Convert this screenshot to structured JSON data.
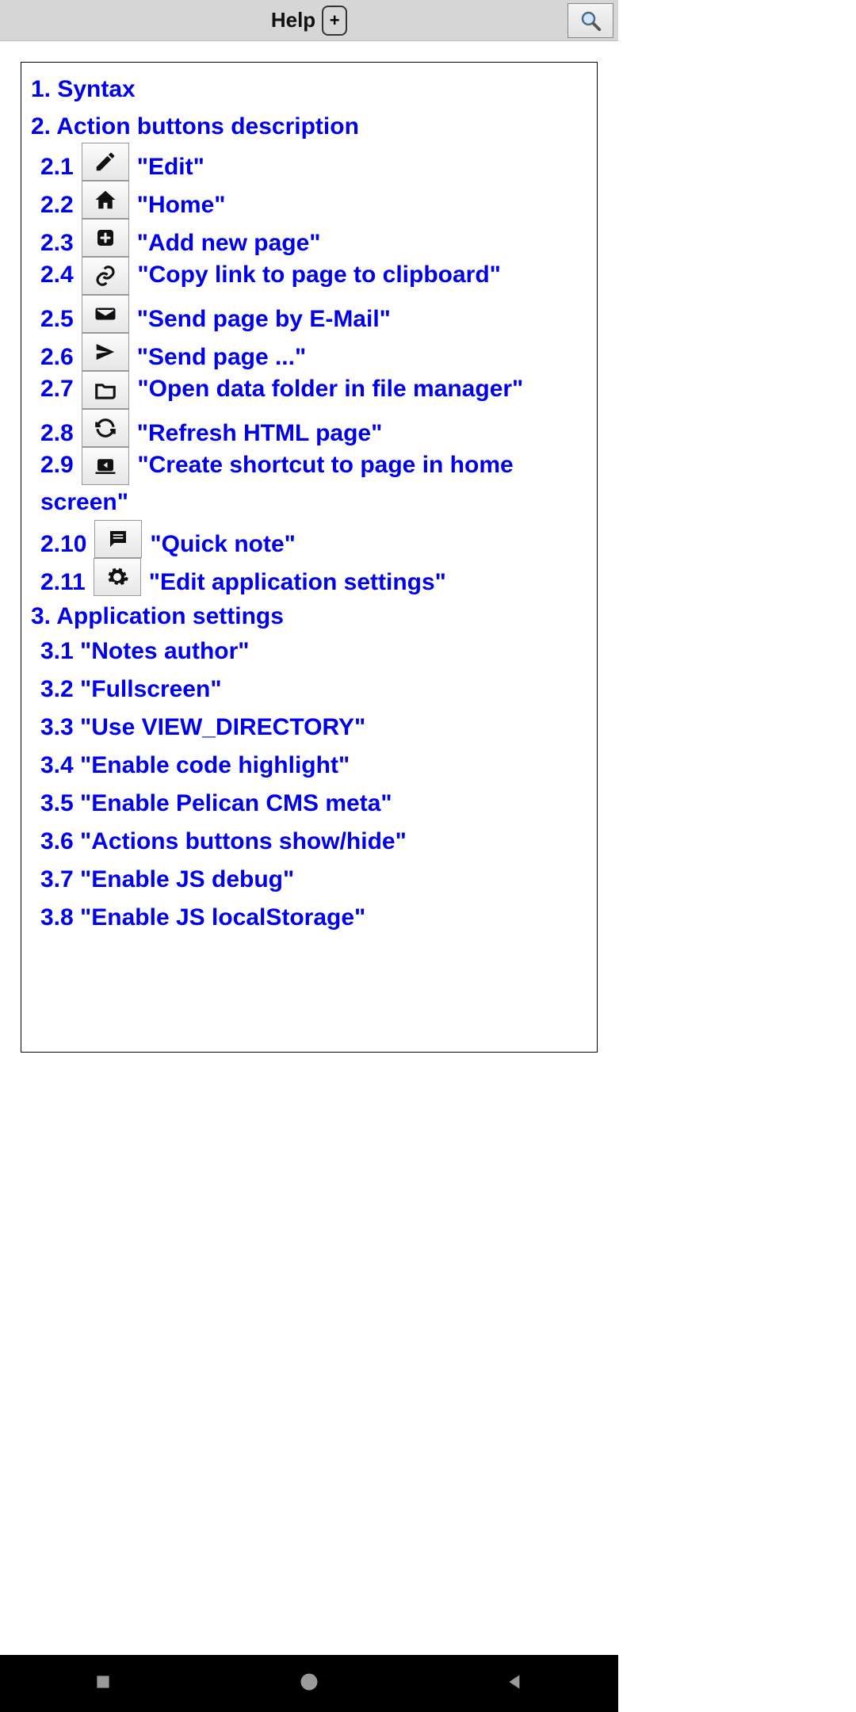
{
  "header": {
    "title": "Help",
    "plus": "+",
    "search_icon": "search-icon"
  },
  "toc": {
    "s1": "1. Syntax",
    "s2": "2. Action buttons description",
    "s2_items": [
      {
        "num": "2.1",
        "icon": "pencil-icon",
        "label": "\"Edit\""
      },
      {
        "num": "2.2",
        "icon": "home-icon",
        "label": "\"Home\""
      },
      {
        "num": "2.3",
        "icon": "add-box-icon",
        "label": "\"Add new page\""
      },
      {
        "num": "2.4",
        "icon": "link-icon",
        "label": "\"Copy link to page to clipboard\""
      },
      {
        "num": "2.5",
        "icon": "mail-icon",
        "label": "\"Send page by E-Mail\""
      },
      {
        "num": "2.6",
        "icon": "send-icon",
        "label": "\"Send page ...\""
      },
      {
        "num": "2.7",
        "icon": "folder-icon",
        "label": "\"Open data folder in file manager\""
      },
      {
        "num": "2.8",
        "icon": "refresh-icon",
        "label": "\"Refresh HTML page\""
      },
      {
        "num": "2.9",
        "icon": "shortcut-icon",
        "label": "\"Create shortcut to page in home screen\""
      },
      {
        "num": "2.10",
        "icon": "note-icon",
        "label": "\"Quick note\""
      },
      {
        "num": "2.11",
        "icon": "gear-icon",
        "label": "\"Edit application settings\""
      }
    ],
    "s3": "3. Application settings",
    "s3_items": [
      "3.1 \"Notes author\"",
      "3.2 \"Fullscreen\"",
      "3.3 \"Use VIEW_DIRECTORY\"",
      "3.4 \"Enable code highlight\"",
      "3.5 \"Enable Pelican CMS meta\"",
      "3.6 \"Actions buttons show/hide\"",
      "3.7 \"Enable JS debug\"",
      "3.8 \"Enable JS localStorage\""
    ]
  }
}
